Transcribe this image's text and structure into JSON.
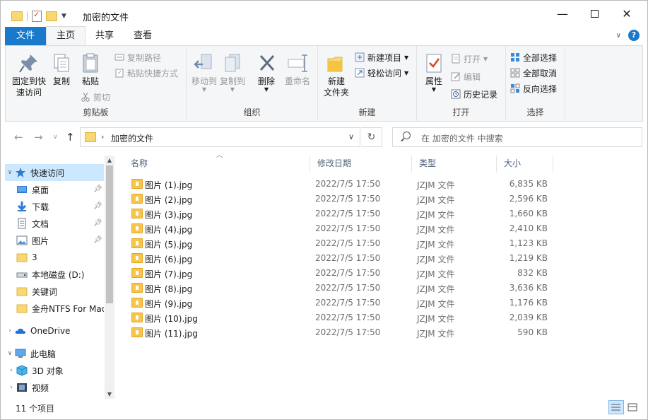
{
  "window": {
    "title": "加密的文件",
    "minimize": "—",
    "close": "✕"
  },
  "tabs": [
    {
      "label": "文件"
    },
    {
      "label": "主页"
    },
    {
      "label": "共享"
    },
    {
      "label": "查看"
    }
  ],
  "ribbon": {
    "clipboard": {
      "label": "剪贴板",
      "pin_quick": "固定到快\n速访问",
      "copy": "复制",
      "paste": "粘贴",
      "copy_path": "复制路径",
      "paste_shortcut": "粘贴快捷方式",
      "cut": "剪切"
    },
    "organize": {
      "label": "组织",
      "move_to": "移动到",
      "copy_to": "复制到",
      "delete": "删除",
      "rename": "重命名"
    },
    "new": {
      "label": "新建",
      "new_folder": "新建\n文件夹",
      "new_item": "新建项目",
      "easy_access": "轻松访问"
    },
    "open": {
      "label": "打开",
      "properties": "属性",
      "open": "打开",
      "edit": "编辑",
      "history": "历史记录"
    },
    "select": {
      "label": "选择",
      "select_all": "全部选择",
      "select_none": "全部取消",
      "invert": "反向选择"
    }
  },
  "address": {
    "path": "加密的文件",
    "search_placeholder": "在 加密的文件 中搜索"
  },
  "nav": {
    "quick_access": "快速访问",
    "items": [
      {
        "label": "桌面"
      },
      {
        "label": "下载"
      },
      {
        "label": "文档"
      },
      {
        "label": "图片"
      },
      {
        "label": "3"
      },
      {
        "label": "本地磁盘 (D:)"
      },
      {
        "label": "关键词"
      },
      {
        "label": "金舟NTFS For Mac"
      }
    ],
    "onedrive": "OneDrive",
    "this_pc": "此电脑",
    "pc_items": [
      {
        "label": "3D 对象"
      },
      {
        "label": "视频"
      }
    ]
  },
  "columns": {
    "name": "名称",
    "date": "修改日期",
    "type": "类型",
    "size": "大小"
  },
  "files": [
    {
      "name": "图片 (1).jpg",
      "date": "2022/7/5 17:50",
      "type": "JZJM 文件",
      "size": "6,835 KB"
    },
    {
      "name": "图片 (2).jpg",
      "date": "2022/7/5 17:50",
      "type": "JZJM 文件",
      "size": "2,596 KB"
    },
    {
      "name": "图片 (3).jpg",
      "date": "2022/7/5 17:50",
      "type": "JZJM 文件",
      "size": "1,660 KB"
    },
    {
      "name": "图片 (4).jpg",
      "date": "2022/7/5 17:50",
      "type": "JZJM 文件",
      "size": "2,410 KB"
    },
    {
      "name": "图片 (5).jpg",
      "date": "2022/7/5 17:50",
      "type": "JZJM 文件",
      "size": "1,123 KB"
    },
    {
      "name": "图片 (6).jpg",
      "date": "2022/7/5 17:50",
      "type": "JZJM 文件",
      "size": "1,219 KB"
    },
    {
      "name": "图片 (7).jpg",
      "date": "2022/7/5 17:50",
      "type": "JZJM 文件",
      "size": "832 KB"
    },
    {
      "name": "图片 (8).jpg",
      "date": "2022/7/5 17:50",
      "type": "JZJM 文件",
      "size": "3,636 KB"
    },
    {
      "name": "图片 (9).jpg",
      "date": "2022/7/5 17:50",
      "type": "JZJM 文件",
      "size": "1,176 KB"
    },
    {
      "name": "图片 (10).jpg",
      "date": "2022/7/5 17:50",
      "type": "JZJM 文件",
      "size": "2,039 KB"
    },
    {
      "name": "图片 (11).jpg",
      "date": "2022/7/5 17:50",
      "type": "JZJM 文件",
      "size": "590 KB"
    }
  ],
  "status": {
    "count": "11 个项目"
  },
  "colors": {
    "accent": "#1979ca",
    "selection": "#cce8ff",
    "folder": "#f8d775"
  }
}
